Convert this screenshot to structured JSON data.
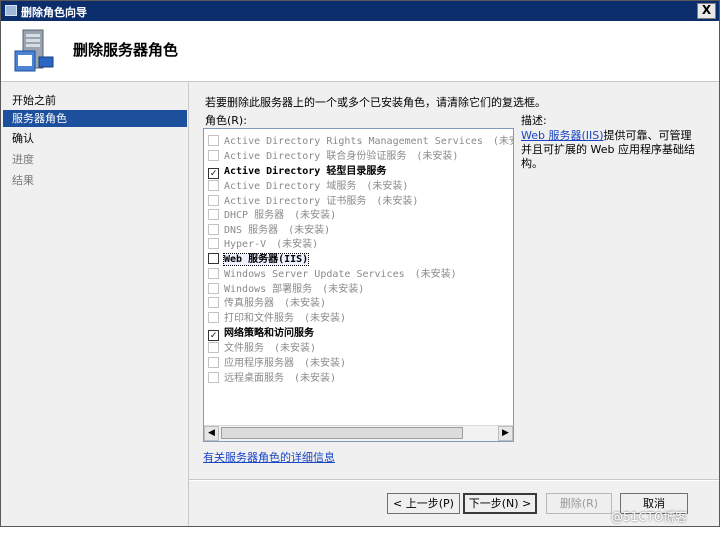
{
  "window": {
    "title": "删除角色向导",
    "close_glyph": "X"
  },
  "header": {
    "title": "删除服务器角色",
    "icon": "server-icon"
  },
  "nav": {
    "items": [
      {
        "label": "开始之前",
        "state": "normal"
      },
      {
        "label": "服务器角色",
        "state": "active"
      },
      {
        "label": "确认",
        "state": "normal"
      },
      {
        "label": "进度",
        "state": "disabled"
      },
      {
        "label": "结果",
        "state": "disabled"
      }
    ]
  },
  "main": {
    "instruction": "若要删除此服务器上的一个或多个已安装角色，请清除它们的复选框。",
    "roles_label": "角色(R):",
    "roles": [
      {
        "label": "Active Directory Rights Management Services",
        "status": "(未安装)",
        "checked": false,
        "enabled": false
      },
      {
        "label": "Active Directory 联合身份验证服务",
        "status": "(未安装)",
        "checked": false,
        "enabled": false
      },
      {
        "label": "Active Directory 轻型目录服务",
        "status": "",
        "checked": true,
        "enabled": true
      },
      {
        "label": "Active Directory 域服务",
        "status": "(未安装)",
        "checked": false,
        "enabled": false
      },
      {
        "label": "Active Directory 证书服务",
        "status": "(未安装)",
        "checked": false,
        "enabled": false
      },
      {
        "label": "DHCP 服务器",
        "status": "(未安装)",
        "checked": false,
        "enabled": false
      },
      {
        "label": "DNS 服务器",
        "status": "(未安装)",
        "checked": false,
        "enabled": false
      },
      {
        "label": "Hyper-V",
        "status": "(未安装)",
        "checked": false,
        "enabled": false
      },
      {
        "label": "Web 服务器(IIS)",
        "status": "",
        "checked": false,
        "enabled": true,
        "selected": true
      },
      {
        "label": "Windows Server Update Services",
        "status": "(未安装)",
        "checked": false,
        "enabled": false
      },
      {
        "label": "Windows 部署服务",
        "status": "(未安装)",
        "checked": false,
        "enabled": false
      },
      {
        "label": "传真服务器",
        "status": "(未安装)",
        "checked": false,
        "enabled": false
      },
      {
        "label": "打印和文件服务",
        "status": "(未安装)",
        "checked": false,
        "enabled": false
      },
      {
        "label": "网络策略和访问服务",
        "status": "",
        "checked": true,
        "enabled": true
      },
      {
        "label": "文件服务",
        "status": "(未安装)",
        "checked": false,
        "enabled": false
      },
      {
        "label": "应用程序服务器",
        "status": "(未安装)",
        "checked": false,
        "enabled": false
      },
      {
        "label": "远程桌面服务",
        "status": "(未安装)",
        "checked": false,
        "enabled": false
      }
    ],
    "scroll_left": "◀",
    "scroll_right": "▶",
    "more_info_link": "有关服务器角色的详细信息"
  },
  "description": {
    "label": "描述:",
    "link": "Web 服务器(IIS)",
    "text": "提供可靠、可管理并且可扩展的 Web 应用程序基础结构。"
  },
  "buttons": {
    "back": "< 上一步(P)",
    "next": "下一步(N) >",
    "remove": "删除(R)",
    "cancel": "取消"
  },
  "watermark": "@51CTO博客",
  "colors": {
    "titlebar": "#0b2d6b",
    "nav_active": "#1c4f9c",
    "link": "#1a44c4"
  }
}
